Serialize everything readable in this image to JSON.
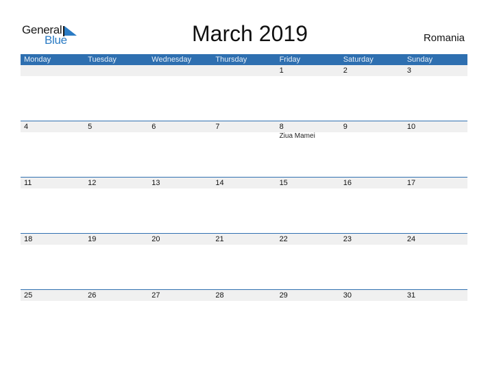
{
  "logo": {
    "line1": "General",
    "line2": "Blue"
  },
  "header": {
    "title": "March 2019",
    "country": "Romania"
  },
  "colors": {
    "accent": "#2e6fb0",
    "band": "#f0f0f0"
  },
  "weekdays": [
    "Monday",
    "Tuesday",
    "Wednesday",
    "Thursday",
    "Friday",
    "Saturday",
    "Sunday"
  ],
  "weeks": [
    {
      "days": [
        "",
        "",
        "",
        "",
        "1",
        "2",
        "3"
      ],
      "events": [
        "",
        "",
        "",
        "",
        "",
        "",
        ""
      ]
    },
    {
      "days": [
        "4",
        "5",
        "6",
        "7",
        "8",
        "9",
        "10"
      ],
      "events": [
        "",
        "",
        "",
        "",
        "Ziua Mamei",
        "",
        ""
      ]
    },
    {
      "days": [
        "11",
        "12",
        "13",
        "14",
        "15",
        "16",
        "17"
      ],
      "events": [
        "",
        "",
        "",
        "",
        "",
        "",
        ""
      ]
    },
    {
      "days": [
        "18",
        "19",
        "20",
        "21",
        "22",
        "23",
        "24"
      ],
      "events": [
        "",
        "",
        "",
        "",
        "",
        "",
        ""
      ]
    },
    {
      "days": [
        "25",
        "26",
        "27",
        "28",
        "29",
        "30",
        "31"
      ],
      "events": [
        "",
        "",
        "",
        "",
        "",
        "",
        ""
      ]
    }
  ]
}
